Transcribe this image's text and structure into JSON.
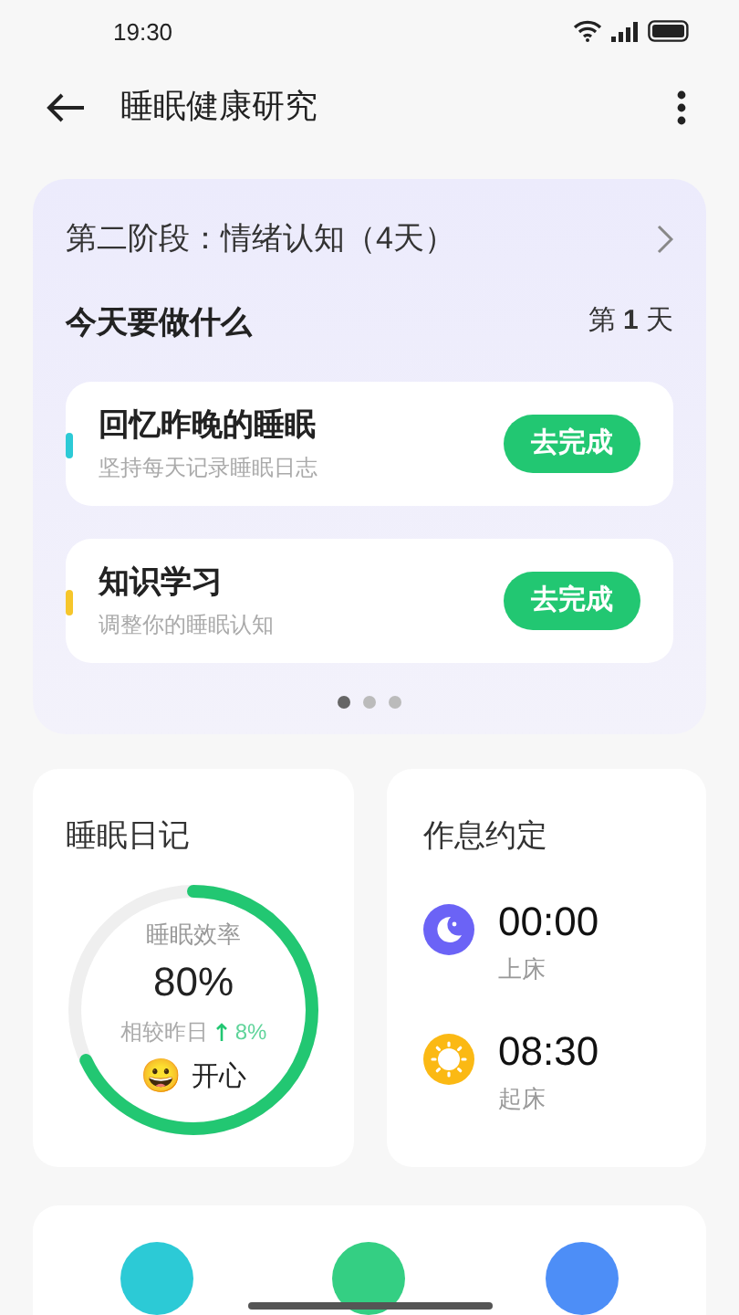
{
  "status_bar": {
    "time": "19:30"
  },
  "header": {
    "title": "睡眠健康研究"
  },
  "stage_card": {
    "stage": "第二阶段：情绪认知（4天）",
    "today_label": "今天要做什么",
    "day": "第 **1** 天",
    "tasks": [
      {
        "title": "回忆昨晚的睡眠",
        "subtitle": "坚持每天记录睡眠日志",
        "button": "去完成",
        "color": "#2ccad6"
      },
      {
        "title": "知识学习",
        "subtitle": "调整你的睡眠认知",
        "button": "去完成",
        "color": "#f6c62b"
      }
    ],
    "pages": [
      {
        "selected": true
      },
      {
        "selected": false
      },
      {
        "selected": false
      }
    ]
  },
  "diary": {
    "title": "睡眠日记",
    "label": "睡眠效率",
    "value": "80%",
    "level": 0.68,
    "compare_label": "相较昨日",
    "change": "8%",
    "mood_emoji": "😀",
    "mood": "开心"
  },
  "schedule": {
    "title": "作息约定",
    "items": [
      {
        "kind": "moon",
        "time": "00:00",
        "label": "上床"
      },
      {
        "kind": "sun",
        "time": "08:30",
        "label": "起床"
      }
    ]
  },
  "shortcuts": [
    {
      "color": "#2ccad6"
    },
    {
      "color": "#34cf83"
    },
    {
      "color": "#4d8ef7"
    }
  ]
}
